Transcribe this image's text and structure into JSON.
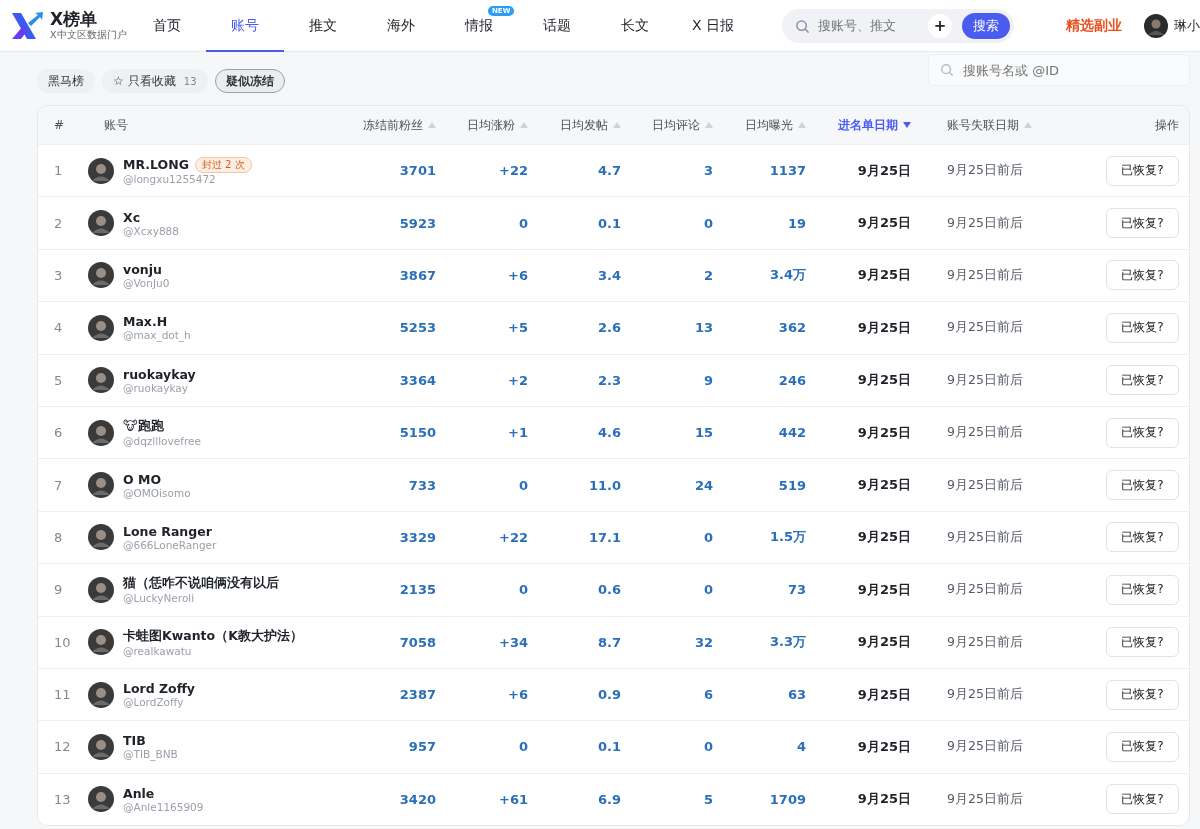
{
  "brand": {
    "name": "X榜单",
    "tagline": "X中文区数据门户"
  },
  "nav": [
    {
      "label": "首页",
      "selected": false
    },
    {
      "label": "账号",
      "selected": true
    },
    {
      "label": "推文",
      "selected": false
    },
    {
      "label": "海外",
      "selected": false
    },
    {
      "label": "情报",
      "selected": false,
      "badge": "NEW"
    },
    {
      "label": "话题",
      "selected": false
    },
    {
      "label": "长文",
      "selected": false
    },
    {
      "label": "X 日报",
      "selected": false
    }
  ],
  "global_search": {
    "placeholder": "搜账号、推文",
    "add_label": "+",
    "button": "搜索"
  },
  "promo_link": "精选副业",
  "user": {
    "name": "琳小"
  },
  "filters": [
    {
      "label": "黑马榜",
      "selected": false
    },
    {
      "label": "只看收藏",
      "icon": "☆",
      "count": "13",
      "selected": false
    },
    {
      "label": "疑似冻结",
      "selected": true
    }
  ],
  "account_search": {
    "placeholder": "搜账号名或 @ID"
  },
  "table": {
    "columns": [
      {
        "label": "#"
      },
      {
        "label": "账号"
      },
      {
        "label": "冻结前粉丝",
        "selected": false
      },
      {
        "label": "日均涨粉",
        "selected": false
      },
      {
        "label": "日均发帖",
        "selected": false
      },
      {
        "label": "日均评论",
        "selected": false
      },
      {
        "label": "日均曝光",
        "selected": false
      },
      {
        "label": "进名单日期",
        "selected": true
      },
      {
        "label": "账号失联日期",
        "selected": false
      },
      {
        "label": "操作"
      }
    ],
    "rows": [
      {
        "rank": "1",
        "name": "MR.LONG",
        "badge": "封过 2 次",
        "handle": "@longxu1255472",
        "followers": "3701",
        "daily_growth": "+22",
        "daily_posts": "4.7",
        "daily_comments": "3",
        "daily_views": "1137",
        "listed_date": "9月25日",
        "lost_date": "9月25日前后",
        "action": "已恢复?"
      },
      {
        "rank": "2",
        "name": "Xc",
        "handle": "@Xcxy888",
        "followers": "5923",
        "daily_growth": "0",
        "daily_posts": "0.1",
        "daily_comments": "0",
        "daily_views": "19",
        "listed_date": "9月25日",
        "lost_date": "9月25日前后",
        "action": "已恢复?"
      },
      {
        "rank": "3",
        "name": "vonju",
        "handle": "@VonJu0",
        "followers": "3867",
        "daily_growth": "+6",
        "daily_posts": "3.4",
        "daily_comments": "2",
        "daily_views": "3.4万",
        "listed_date": "9月25日",
        "lost_date": "9月25日前后",
        "action": "已恢复?"
      },
      {
        "rank": "4",
        "name": "Max.H",
        "handle": "@max_dot_h",
        "followers": "5253",
        "daily_growth": "+5",
        "daily_posts": "2.6",
        "daily_comments": "13",
        "daily_views": "362",
        "listed_date": "9月25日",
        "lost_date": "9月25日前后",
        "action": "已恢复?"
      },
      {
        "rank": "5",
        "name": "ruokaykay",
        "handle": "@ruokaykay",
        "followers": "3364",
        "daily_growth": "+2",
        "daily_posts": "2.3",
        "daily_comments": "9",
        "daily_views": "246",
        "listed_date": "9月25日",
        "lost_date": "9月25日前后",
        "action": "已恢复?"
      },
      {
        "rank": "6",
        "name": "🐮跑跑",
        "handle": "@dqzlllovefree",
        "followers": "5150",
        "daily_growth": "+1",
        "daily_posts": "4.6",
        "daily_comments": "15",
        "daily_views": "442",
        "listed_date": "9月25日",
        "lost_date": "9月25日前后",
        "action": "已恢复?"
      },
      {
        "rank": "7",
        "name": "O MO",
        "handle": "@OMOisomo",
        "followers": "733",
        "daily_growth": "0",
        "daily_posts": "11.0",
        "daily_comments": "24",
        "daily_views": "519",
        "listed_date": "9月25日",
        "lost_date": "9月25日前后",
        "action": "已恢复?"
      },
      {
        "rank": "8",
        "name": "Lone Ranger",
        "handle": "@666LoneRanger",
        "followers": "3329",
        "daily_growth": "+22",
        "daily_posts": "17.1",
        "daily_comments": "0",
        "daily_views": "1.5万",
        "listed_date": "9月25日",
        "lost_date": "9月25日前后",
        "action": "已恢复?"
      },
      {
        "rank": "9",
        "name": "猫（恁咋不说咱俩没有以后",
        "handle": "@LuckyNeroli",
        "followers": "2135",
        "daily_growth": "0",
        "daily_posts": "0.6",
        "daily_comments": "0",
        "daily_views": "73",
        "listed_date": "9月25日",
        "lost_date": "9月25日前后",
        "action": "已恢复?"
      },
      {
        "rank": "10",
        "name": "卡蛙图Kwanto（K教大护法）",
        "handle": "@realkawatu",
        "followers": "7058",
        "daily_growth": "+34",
        "daily_posts": "8.7",
        "daily_comments": "32",
        "daily_views": "3.3万",
        "listed_date": "9月25日",
        "lost_date": "9月25日前后",
        "action": "已恢复?"
      },
      {
        "rank": "11",
        "name": "Lord Zoffy",
        "handle": "@LordZoffy",
        "followers": "2387",
        "daily_growth": "+6",
        "daily_posts": "0.9",
        "daily_comments": "6",
        "daily_views": "63",
        "listed_date": "9月25日",
        "lost_date": "9月25日前后",
        "action": "已恢复?"
      },
      {
        "rank": "12",
        "name": "TIB",
        "handle": "@TIB_BNB",
        "followers": "957",
        "daily_growth": "0",
        "daily_posts": "0.1",
        "daily_comments": "0",
        "daily_views": "4",
        "listed_date": "9月25日",
        "lost_date": "9月25日前后",
        "action": "已恢复?"
      },
      {
        "rank": "13",
        "name": "Anle",
        "handle": "@Anle1165909",
        "followers": "3420",
        "daily_growth": "+61",
        "daily_posts": "6.9",
        "daily_comments": "5",
        "daily_views": "1709",
        "listed_date": "9月25日",
        "lost_date": "9月25日前后",
        "action": "已恢复?"
      }
    ]
  }
}
